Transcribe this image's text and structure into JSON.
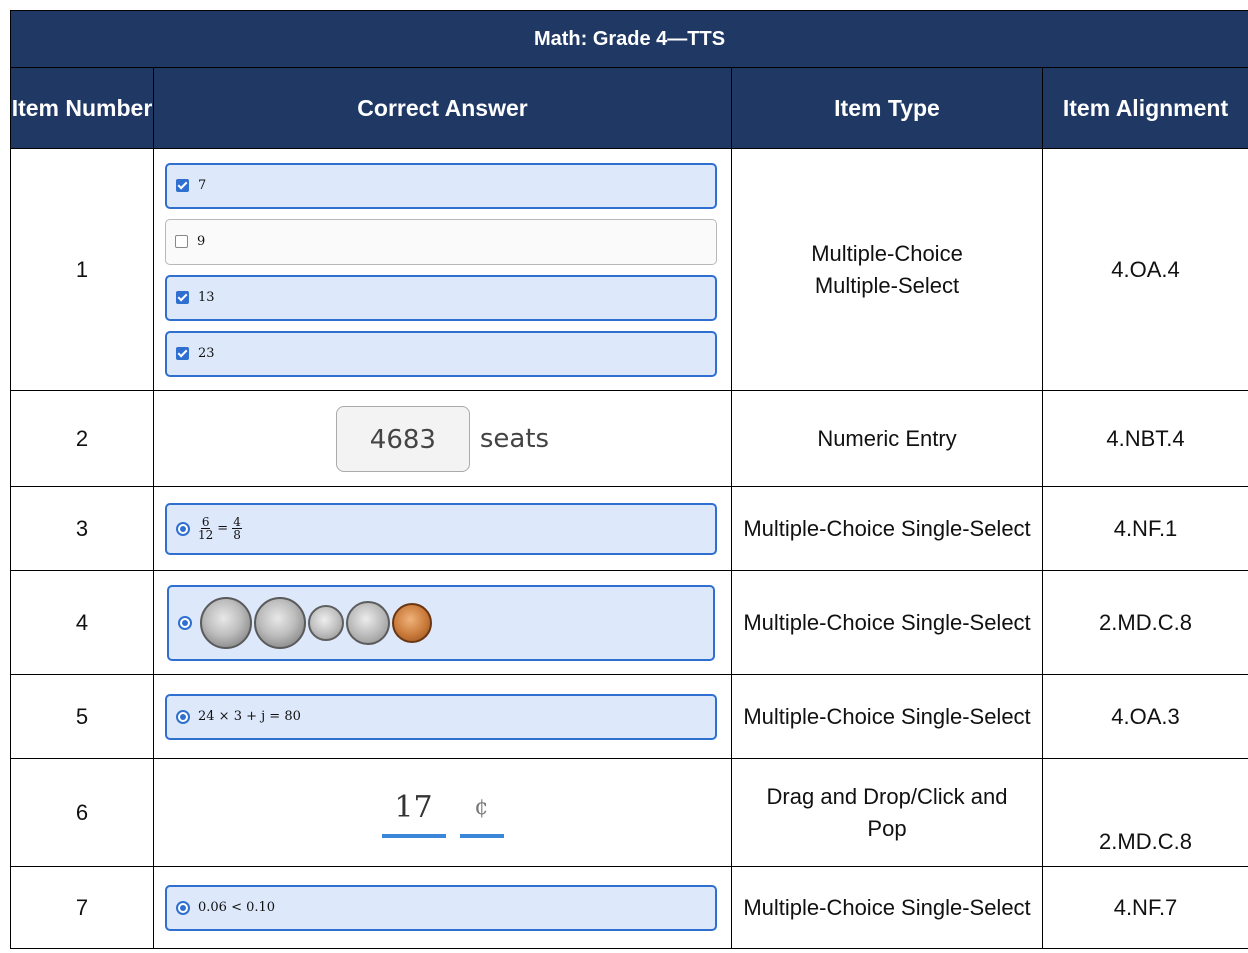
{
  "table": {
    "title": "Math: Grade 4—TTS",
    "headers": [
      "Item Number",
      "Correct Answer",
      "Item Type",
      "Item Alignment"
    ]
  },
  "rows": [
    {
      "number": "1",
      "answer_options": [
        {
          "label": "7",
          "checked": true
        },
        {
          "label": "9",
          "checked": false
        },
        {
          "label": "13",
          "checked": true
        },
        {
          "label": "23",
          "checked": true
        }
      ],
      "type": "Multiple-Choice Multiple-Select",
      "alignment": "4.OA.4"
    },
    {
      "number": "2",
      "answer_value": "4683",
      "answer_unit": "seats",
      "type": "Numeric Entry",
      "alignment": "4.NBT.4"
    },
    {
      "number": "3",
      "answer_fraction": {
        "left_num": "6",
        "left_den": "12",
        "op": "=",
        "right_num": "4",
        "right_den": "8"
      },
      "type": "Multiple-Choice Single-Select",
      "alignment": "4.NF.1"
    },
    {
      "number": "4",
      "answer_coins": [
        "quarter-icon",
        "quarter-icon",
        "dime-icon",
        "nickel-icon",
        "penny-icon"
      ],
      "type": "Multiple-Choice Single-Select",
      "alignment": "2.MD.C.8"
    },
    {
      "number": "5",
      "answer_expression": "24 × 3 + j = 80",
      "type": "Multiple-Choice Single-Select",
      "alignment": "4.OA.3"
    },
    {
      "number": "6",
      "answer_value": "17",
      "answer_unit": "¢",
      "type": "Drag and Drop/Click and Pop",
      "alignment": "2.MD.C.8"
    },
    {
      "number": "7",
      "answer_expression": "0.06 < 0.10",
      "type": "Multiple-Choice Single-Select",
      "alignment": "4.NF.7"
    }
  ],
  "colors": {
    "header_bg": "#1f3864",
    "selected_bg": "#dde9fb",
    "accent": "#2f6fd0"
  }
}
